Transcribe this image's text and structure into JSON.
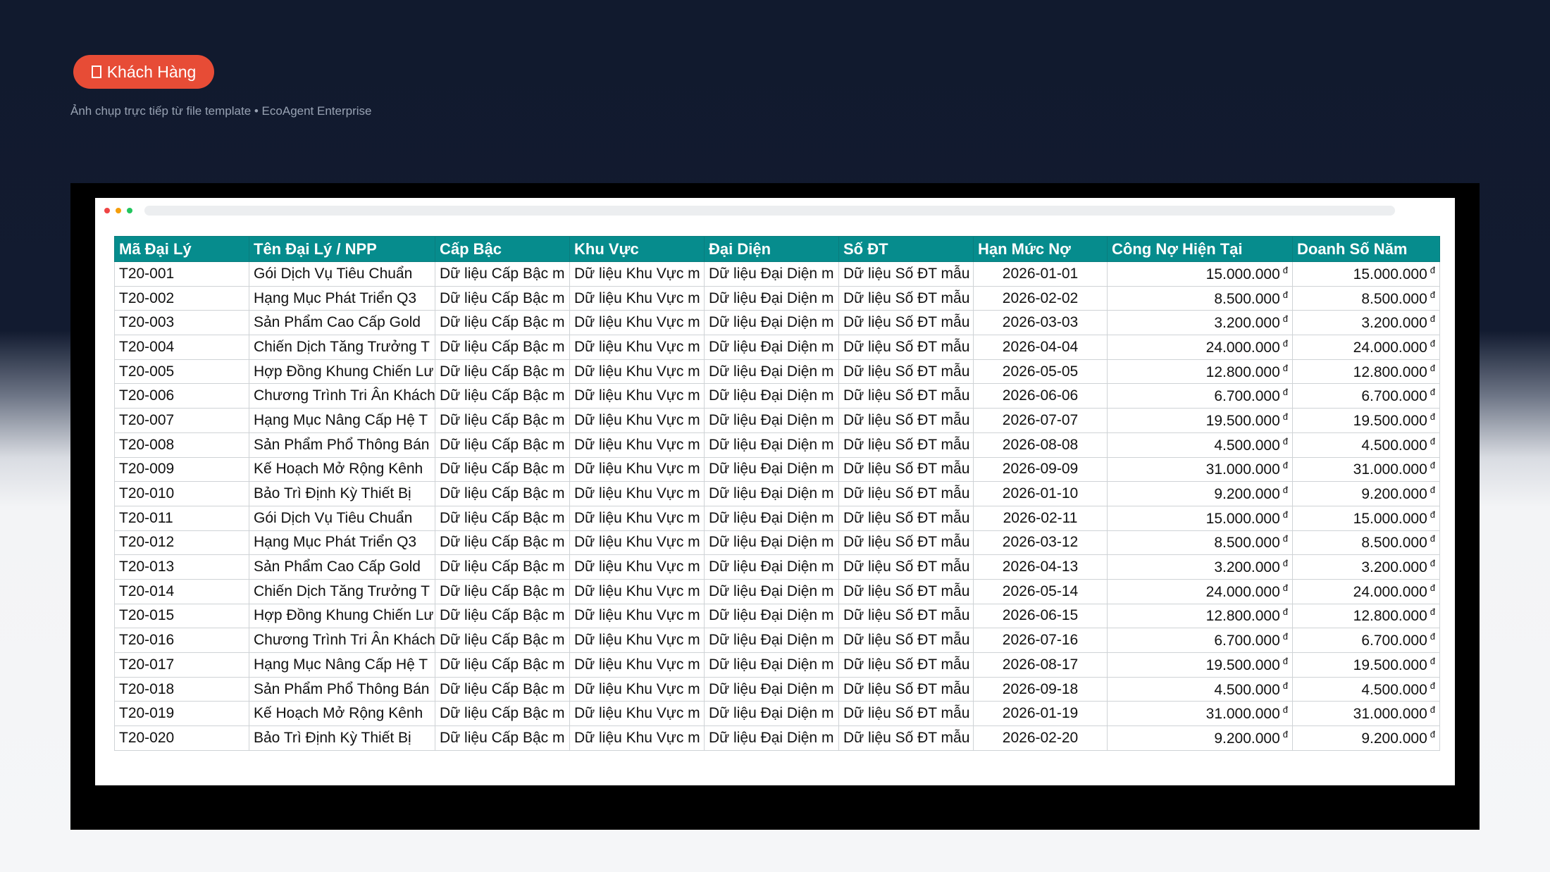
{
  "badge": {
    "icon": "square-outline-icon",
    "label": "Khách Hàng"
  },
  "caption": "Ảnh chụp trực tiếp từ file template • EcoAgent Enterprise",
  "window_dots": [
    {
      "name": "close-dot",
      "color": "#ef4444"
    },
    {
      "name": "minimize-dot",
      "color": "#f59e0b"
    },
    {
      "name": "maximize-dot",
      "color": "#22c55e"
    }
  ],
  "table": {
    "header_color": "#068c8d",
    "columns": [
      "Mã Đại Lý",
      "Tên Đại Lý / NPP",
      "Cấp Bậc",
      "Khu Vực",
      "Đại Diện",
      "Số ĐT",
      "Hạn Mức Nợ",
      "Công Nợ Hiện Tại",
      "Doanh Số Năm"
    ],
    "currency_symbol": "đ",
    "rows": [
      [
        "T20-001",
        "Gói Dịch Vụ Tiêu Chuẩn",
        "Dữ liệu Cấp Bậc m",
        "Dữ liệu Khu Vực m",
        "Dữ liệu Đại Diện m",
        "Dữ liệu Số ĐT mẫu",
        "2026-01-01",
        "15.000.000",
        "15.000.000"
      ],
      [
        "T20-002",
        "Hạng Mục Phát Triển Q3",
        "Dữ liệu Cấp Bậc m",
        "Dữ liệu Khu Vực m",
        "Dữ liệu Đại Diện m",
        "Dữ liệu Số ĐT mẫu",
        "2026-02-02",
        "8.500.000",
        "8.500.000"
      ],
      [
        "T20-003",
        "Sản Phẩm Cao Cấp Gold",
        "Dữ liệu Cấp Bậc m",
        "Dữ liệu Khu Vực m",
        "Dữ liệu Đại Diện m",
        "Dữ liệu Số ĐT mẫu",
        "2026-03-03",
        "3.200.000",
        "3.200.000"
      ],
      [
        "T20-004",
        "Chiến Dịch Tăng Trưởng T",
        "Dữ liệu Cấp Bậc m",
        "Dữ liệu Khu Vực m",
        "Dữ liệu Đại Diện m",
        "Dữ liệu Số ĐT mẫu",
        "2026-04-04",
        "24.000.000",
        "24.000.000"
      ],
      [
        "T20-005",
        "Hợp Đồng Khung Chiến Lư",
        "Dữ liệu Cấp Bậc m",
        "Dữ liệu Khu Vực m",
        "Dữ liệu Đại Diện m",
        "Dữ liệu Số ĐT mẫu",
        "2026-05-05",
        "12.800.000",
        "12.800.000"
      ],
      [
        "T20-006",
        "Chương Trình Tri Ân Khách",
        "Dữ liệu Cấp Bậc m",
        "Dữ liệu Khu Vực m",
        "Dữ liệu Đại Diện m",
        "Dữ liệu Số ĐT mẫu",
        "2026-06-06",
        "6.700.000",
        "6.700.000"
      ],
      [
        "T20-007",
        "Hạng Mục Nâng Cấp Hệ T",
        "Dữ liệu Cấp Bậc m",
        "Dữ liệu Khu Vực m",
        "Dữ liệu Đại Diện m",
        "Dữ liệu Số ĐT mẫu",
        "2026-07-07",
        "19.500.000",
        "19.500.000"
      ],
      [
        "T20-008",
        "Sản Phẩm Phổ Thông Bán",
        "Dữ liệu Cấp Bậc m",
        "Dữ liệu Khu Vực m",
        "Dữ liệu Đại Diện m",
        "Dữ liệu Số ĐT mẫu",
        "2026-08-08",
        "4.500.000",
        "4.500.000"
      ],
      [
        "T20-009",
        "Kế Hoạch Mở Rộng Kênh",
        "Dữ liệu Cấp Bậc m",
        "Dữ liệu Khu Vực m",
        "Dữ liệu Đại Diện m",
        "Dữ liệu Số ĐT mẫu",
        "2026-09-09",
        "31.000.000",
        "31.000.000"
      ],
      [
        "T20-010",
        "Bảo Trì Định Kỳ Thiết Bị",
        "Dữ liệu Cấp Bậc m",
        "Dữ liệu Khu Vực m",
        "Dữ liệu Đại Diện m",
        "Dữ liệu Số ĐT mẫu",
        "2026-01-10",
        "9.200.000",
        "9.200.000"
      ],
      [
        "T20-011",
        "Gói Dịch Vụ Tiêu Chuẩn",
        "Dữ liệu Cấp Bậc m",
        "Dữ liệu Khu Vực m",
        "Dữ liệu Đại Diện m",
        "Dữ liệu Số ĐT mẫu",
        "2026-02-11",
        "15.000.000",
        "15.000.000"
      ],
      [
        "T20-012",
        "Hạng Mục Phát Triển Q3",
        "Dữ liệu Cấp Bậc m",
        "Dữ liệu Khu Vực m",
        "Dữ liệu Đại Diện m",
        "Dữ liệu Số ĐT mẫu",
        "2026-03-12",
        "8.500.000",
        "8.500.000"
      ],
      [
        "T20-013",
        "Sản Phẩm Cao Cấp Gold",
        "Dữ liệu Cấp Bậc m",
        "Dữ liệu Khu Vực m",
        "Dữ liệu Đại Diện m",
        "Dữ liệu Số ĐT mẫu",
        "2026-04-13",
        "3.200.000",
        "3.200.000"
      ],
      [
        "T20-014",
        "Chiến Dịch Tăng Trưởng T",
        "Dữ liệu Cấp Bậc m",
        "Dữ liệu Khu Vực m",
        "Dữ liệu Đại Diện m",
        "Dữ liệu Số ĐT mẫu",
        "2026-05-14",
        "24.000.000",
        "24.000.000"
      ],
      [
        "T20-015",
        "Hợp Đồng Khung Chiến Lư",
        "Dữ liệu Cấp Bậc m",
        "Dữ liệu Khu Vực m",
        "Dữ liệu Đại Diện m",
        "Dữ liệu Số ĐT mẫu",
        "2026-06-15",
        "12.800.000",
        "12.800.000"
      ],
      [
        "T20-016",
        "Chương Trình Tri Ân Khách",
        "Dữ liệu Cấp Bậc m",
        "Dữ liệu Khu Vực m",
        "Dữ liệu Đại Diện m",
        "Dữ liệu Số ĐT mẫu",
        "2026-07-16",
        "6.700.000",
        "6.700.000"
      ],
      [
        "T20-017",
        "Hạng Mục Nâng Cấp Hệ T",
        "Dữ liệu Cấp Bậc m",
        "Dữ liệu Khu Vực m",
        "Dữ liệu Đại Diện m",
        "Dữ liệu Số ĐT mẫu",
        "2026-08-17",
        "19.500.000",
        "19.500.000"
      ],
      [
        "T20-018",
        "Sản Phẩm Phổ Thông Bán",
        "Dữ liệu Cấp Bậc m",
        "Dữ liệu Khu Vực m",
        "Dữ liệu Đại Diện m",
        "Dữ liệu Số ĐT mẫu",
        "2026-09-18",
        "4.500.000",
        "4.500.000"
      ],
      [
        "T20-019",
        "Kế Hoạch Mở Rộng Kênh",
        "Dữ liệu Cấp Bậc m",
        "Dữ liệu Khu Vực m",
        "Dữ liệu Đại Diện m",
        "Dữ liệu Số ĐT mẫu",
        "2026-01-19",
        "31.000.000",
        "31.000.000"
      ],
      [
        "T20-020",
        "Bảo Trì Định Kỳ Thiết Bị",
        "Dữ liệu Cấp Bậc m",
        "Dữ liệu Khu Vực m",
        "Dữ liệu Đại Diện m",
        "Dữ liệu Số ĐT mẫu",
        "2026-02-20",
        "9.200.000",
        "9.200.000"
      ]
    ]
  }
}
